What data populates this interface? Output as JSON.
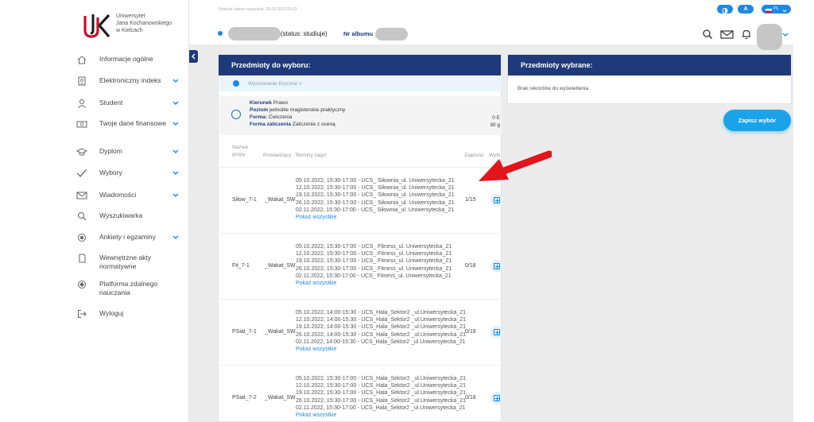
{
  "university": {
    "line1": "Uniwersytet",
    "line2": "Jana Kochanowskiego",
    "line3": "w Kielcach"
  },
  "header": {
    "last_login": "Ostatnie udane logowanie: 26.09.2022 09:23",
    "status": "(status: studiuje)",
    "album_label": "Nr albumu",
    "toolbar_pills": [
      "contrast",
      "A",
      "PL"
    ]
  },
  "sidebar": {
    "items": [
      {
        "label": "Informacje ogólne",
        "icon": "home-icon",
        "expandable": false
      },
      {
        "label": "Elektroniczny indeks",
        "icon": "index-icon",
        "expandable": true
      },
      {
        "label": "Student",
        "icon": "user-icon",
        "expandable": true
      },
      {
        "label": "Twoje dane finansowe",
        "icon": "money-icon",
        "expandable": true
      },
      {
        "label": "Dyplom",
        "icon": "diploma-icon",
        "expandable": true
      },
      {
        "label": "Wybory",
        "icon": "check-icon",
        "expandable": true
      },
      {
        "label": "Wiadomości",
        "icon": "mail-icon",
        "expandable": true
      },
      {
        "label": "Wyszukiwarka",
        "icon": "search-icon",
        "expandable": false
      },
      {
        "label": "Ankiety i egzaminy",
        "icon": "survey-icon",
        "expandable": true
      },
      {
        "label": "Wewnętrzne akty normatywne",
        "icon": "document-icon",
        "expandable": false
      },
      {
        "label": "Platforma zdalnego nauczania",
        "icon": "elearning-icon",
        "expandable": false
      },
      {
        "label": "Wyloguj",
        "icon": "logout-icon",
        "expandable": false
      }
    ]
  },
  "left_panel": {
    "title": "Przedmioty do wyboru:",
    "breadcrumb": "Wychowanie fizyczne >",
    "info": {
      "kierunek_label": "Kierunek",
      "kierunek": "Prawo",
      "poziom_label": "Poziom",
      "poziom": "jednolite magisterskie praktyczny",
      "forma_label": "Forma:",
      "forma": "Ćwiczenia",
      "zaliczenie_label": "Forma zaliczenia",
      "zaliczenie": "Zaliczenie z oceną",
      "right1": "0 E",
      "right2": "30 g"
    },
    "columns": {
      "group_line1": "Nazwa",
      "group_line2": "grupy",
      "lecturer": "Prowadzący",
      "terms": "Terminy zajęć",
      "occupancy": "Zajętość",
      "choice": "Wybi"
    },
    "rows": [
      {
        "group": "Siłow_7-1",
        "lecturer": "_Wakat_SW",
        "occupancy": "1/15",
        "terms": [
          "05.10.2022, 15:30-17:00 - UCS_ Siłownia_ul. Uniwersytecka_21",
          "12.10.2022, 15:30-17:00 - UCS_ Siłownia_ul. Uniwersytecka_21",
          "19.10.2022, 15:30-17:00 - UCS_ Siłownia_ul. Uniwersytecka_21",
          "26.10.2022, 15:30-17:00 - UCS_ Siłownia_ul. Uniwersytecka_21",
          "02.11.2022, 15:30-17:00 - UCS_ Siłownia_ul. Uniwersytecka_21"
        ],
        "more": "Pokaż wszystkie"
      },
      {
        "group": "Fit_7-1",
        "lecturer": "_Wakat_SW",
        "occupancy": "0/18",
        "terms": [
          "05.10.2022, 15:30-17:00 - UCS_ Fitness_ul. Uniwersytecka_21",
          "12.10.2022, 15:30-17:00 - UCS_ Fitness_ul. Uniwersytecka_21",
          "19.10.2022, 15:30-17:00 - UCS_ Fitness_ul. Uniwersytecka_21",
          "26.10.2022, 15:30-17:00 - UCS_ Fitness_ul. Uniwersytecka_21",
          "02.11.2022, 15:30-17:00 - UCS_ Fitness_ul. Uniwersytecka_21"
        ],
        "more": "Pokaż wszystkie"
      },
      {
        "group": "PSiat_7-1",
        "lecturer": "_Wakat_SW",
        "occupancy": "0/18",
        "terms": [
          "05.10.2022, 14:00-15:30 - UCS_Hala_Sektor2 _ul.Uniwersytecka_21",
          "12.10.2022, 14:00-15:30 - UCS_Hala_Sektor2 _ul.Uniwersytecka_21",
          "19.10.2022, 14:00-15:30 - UCS_Hala_Sektor2 _ul.Uniwersytecka_21",
          "26.10.2022, 14:00-15:30 - UCS_Hala_Sektor2 _ul.Uniwersytecka_21",
          "02.11.2022, 14:00-15:30 - UCS_Hala_Sektor2 _ul.Uniwersytecka_21"
        ],
        "more": "Pokaż wszystkie"
      },
      {
        "group": "PSiat_7-2",
        "lecturer": "_Wakat_SW",
        "occupancy": "0/18",
        "terms": [
          "05.10.2022, 15:30-17:00 - UCS_Hala_Sektor2 _ul.Uniwersytecka_21",
          "12.10.2022, 15:30-17:00 - UCS_Hala_Sektor2 _ul.Uniwersytecka_21",
          "19.10.2022, 15:30-17:00 - UCS_Hala_Sektor2 _ul.Uniwersytecka_21",
          "26.10.2022, 15:30-17:00 - UCS_Hala_Sektor2 _ul.Uniwersytecka_21",
          "02.11.2022, 15:30-17:00 - UCS_Hala_Sektor2 _ul.Uniwersytecka_21"
        ],
        "more": "Pokaż wszystkie"
      }
    ]
  },
  "right_panel": {
    "title": "Przedmioty wybrane:",
    "empty": "Brak rekordów do wyświetlenia"
  },
  "save_button": "Zapisz wybór",
  "colors": {
    "navy": "#1f3a7a",
    "accent": "#1e88e5",
    "save": "#1aa3e8",
    "arrow": "#e3141b",
    "logo_red": "#c8102e"
  }
}
